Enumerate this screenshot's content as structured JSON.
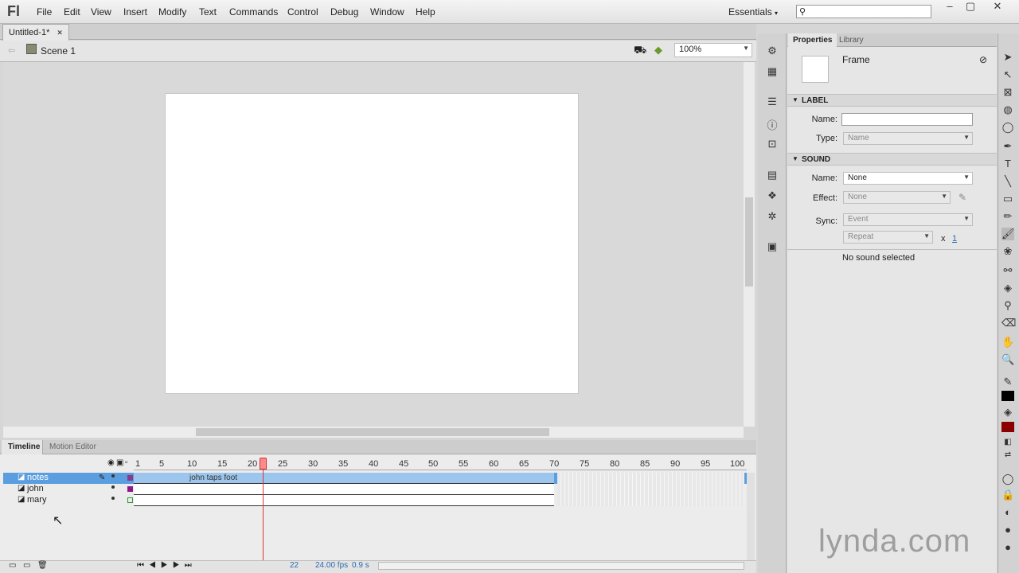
{
  "app": {
    "logo": "Fl",
    "menus": [
      "File",
      "Edit",
      "View",
      "Insert",
      "Modify",
      "Text",
      "Commands",
      "Control",
      "Debug",
      "Window",
      "Help"
    ],
    "workspace": "Essentials"
  },
  "document": {
    "tab": "Untitled-1*",
    "scene": "Scene 1",
    "zoom": "100%"
  },
  "timeline": {
    "tabs": [
      "Timeline",
      "Motion Editor"
    ],
    "ruler": [
      "1",
      "5",
      "10",
      "15",
      "20",
      "25",
      "30",
      "35",
      "40",
      "45",
      "50",
      "55",
      "60",
      "65",
      "70",
      "75",
      "80",
      "85",
      "90",
      "95",
      "100"
    ],
    "layers": [
      {
        "name": "notes"
      },
      {
        "name": "john"
      },
      {
        "name": "mary"
      }
    ],
    "frame_label": "john taps foot",
    "current_frame": "22",
    "fps": "24.00 fps",
    "time": "0.9 s"
  },
  "properties": {
    "tabs": [
      "Properties",
      "Library"
    ],
    "type": "Frame",
    "label": {
      "header": "LABEL",
      "name_label": "Name:",
      "name_value": "",
      "type_label": "Type:",
      "type_value": "Name"
    },
    "sound": {
      "header": "SOUND",
      "name_label": "Name:",
      "name_value": "None",
      "effect_label": "Effect:",
      "effect_value": "None",
      "sync_label": "Sync:",
      "sync_value": "Event",
      "repeat_value": "Repeat",
      "x": "x",
      "repeat_count": "1",
      "status": "No sound selected"
    }
  },
  "watermark": "lynda.com"
}
